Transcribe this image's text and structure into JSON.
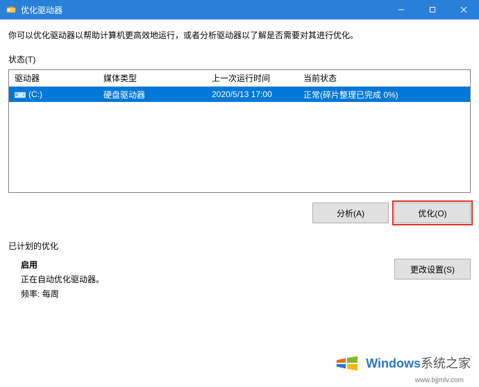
{
  "title": "优化驱动器",
  "description": "你可以优化驱动器以帮助计算机更高效地运行，或者分析驱动器以了解是否需要对其进行优化。",
  "status_label": "状态(T)",
  "table": {
    "headers": {
      "drive": "驱动器",
      "media": "媒体类型",
      "last": "上一次运行时间",
      "status": "当前状态"
    },
    "rows": [
      {
        "drive": "(C:)",
        "media": "硬盘驱动器",
        "last": "2020/5/13 17:00",
        "status": "正常(碎片整理已完成 0%)"
      }
    ]
  },
  "buttons": {
    "analyze": "分析(A)",
    "optimize": "优化(O)",
    "change_settings": "更改设置(S)"
  },
  "schedule": {
    "section_title": "已计划的优化",
    "heading": "启用",
    "line1": "正在自动优化驱动器。",
    "line2_label": "频率:",
    "line2_value": "每周"
  },
  "watermark": {
    "brand": "Windows",
    "suffix": "系统之家",
    "url": "www.bjjmlv.com"
  }
}
